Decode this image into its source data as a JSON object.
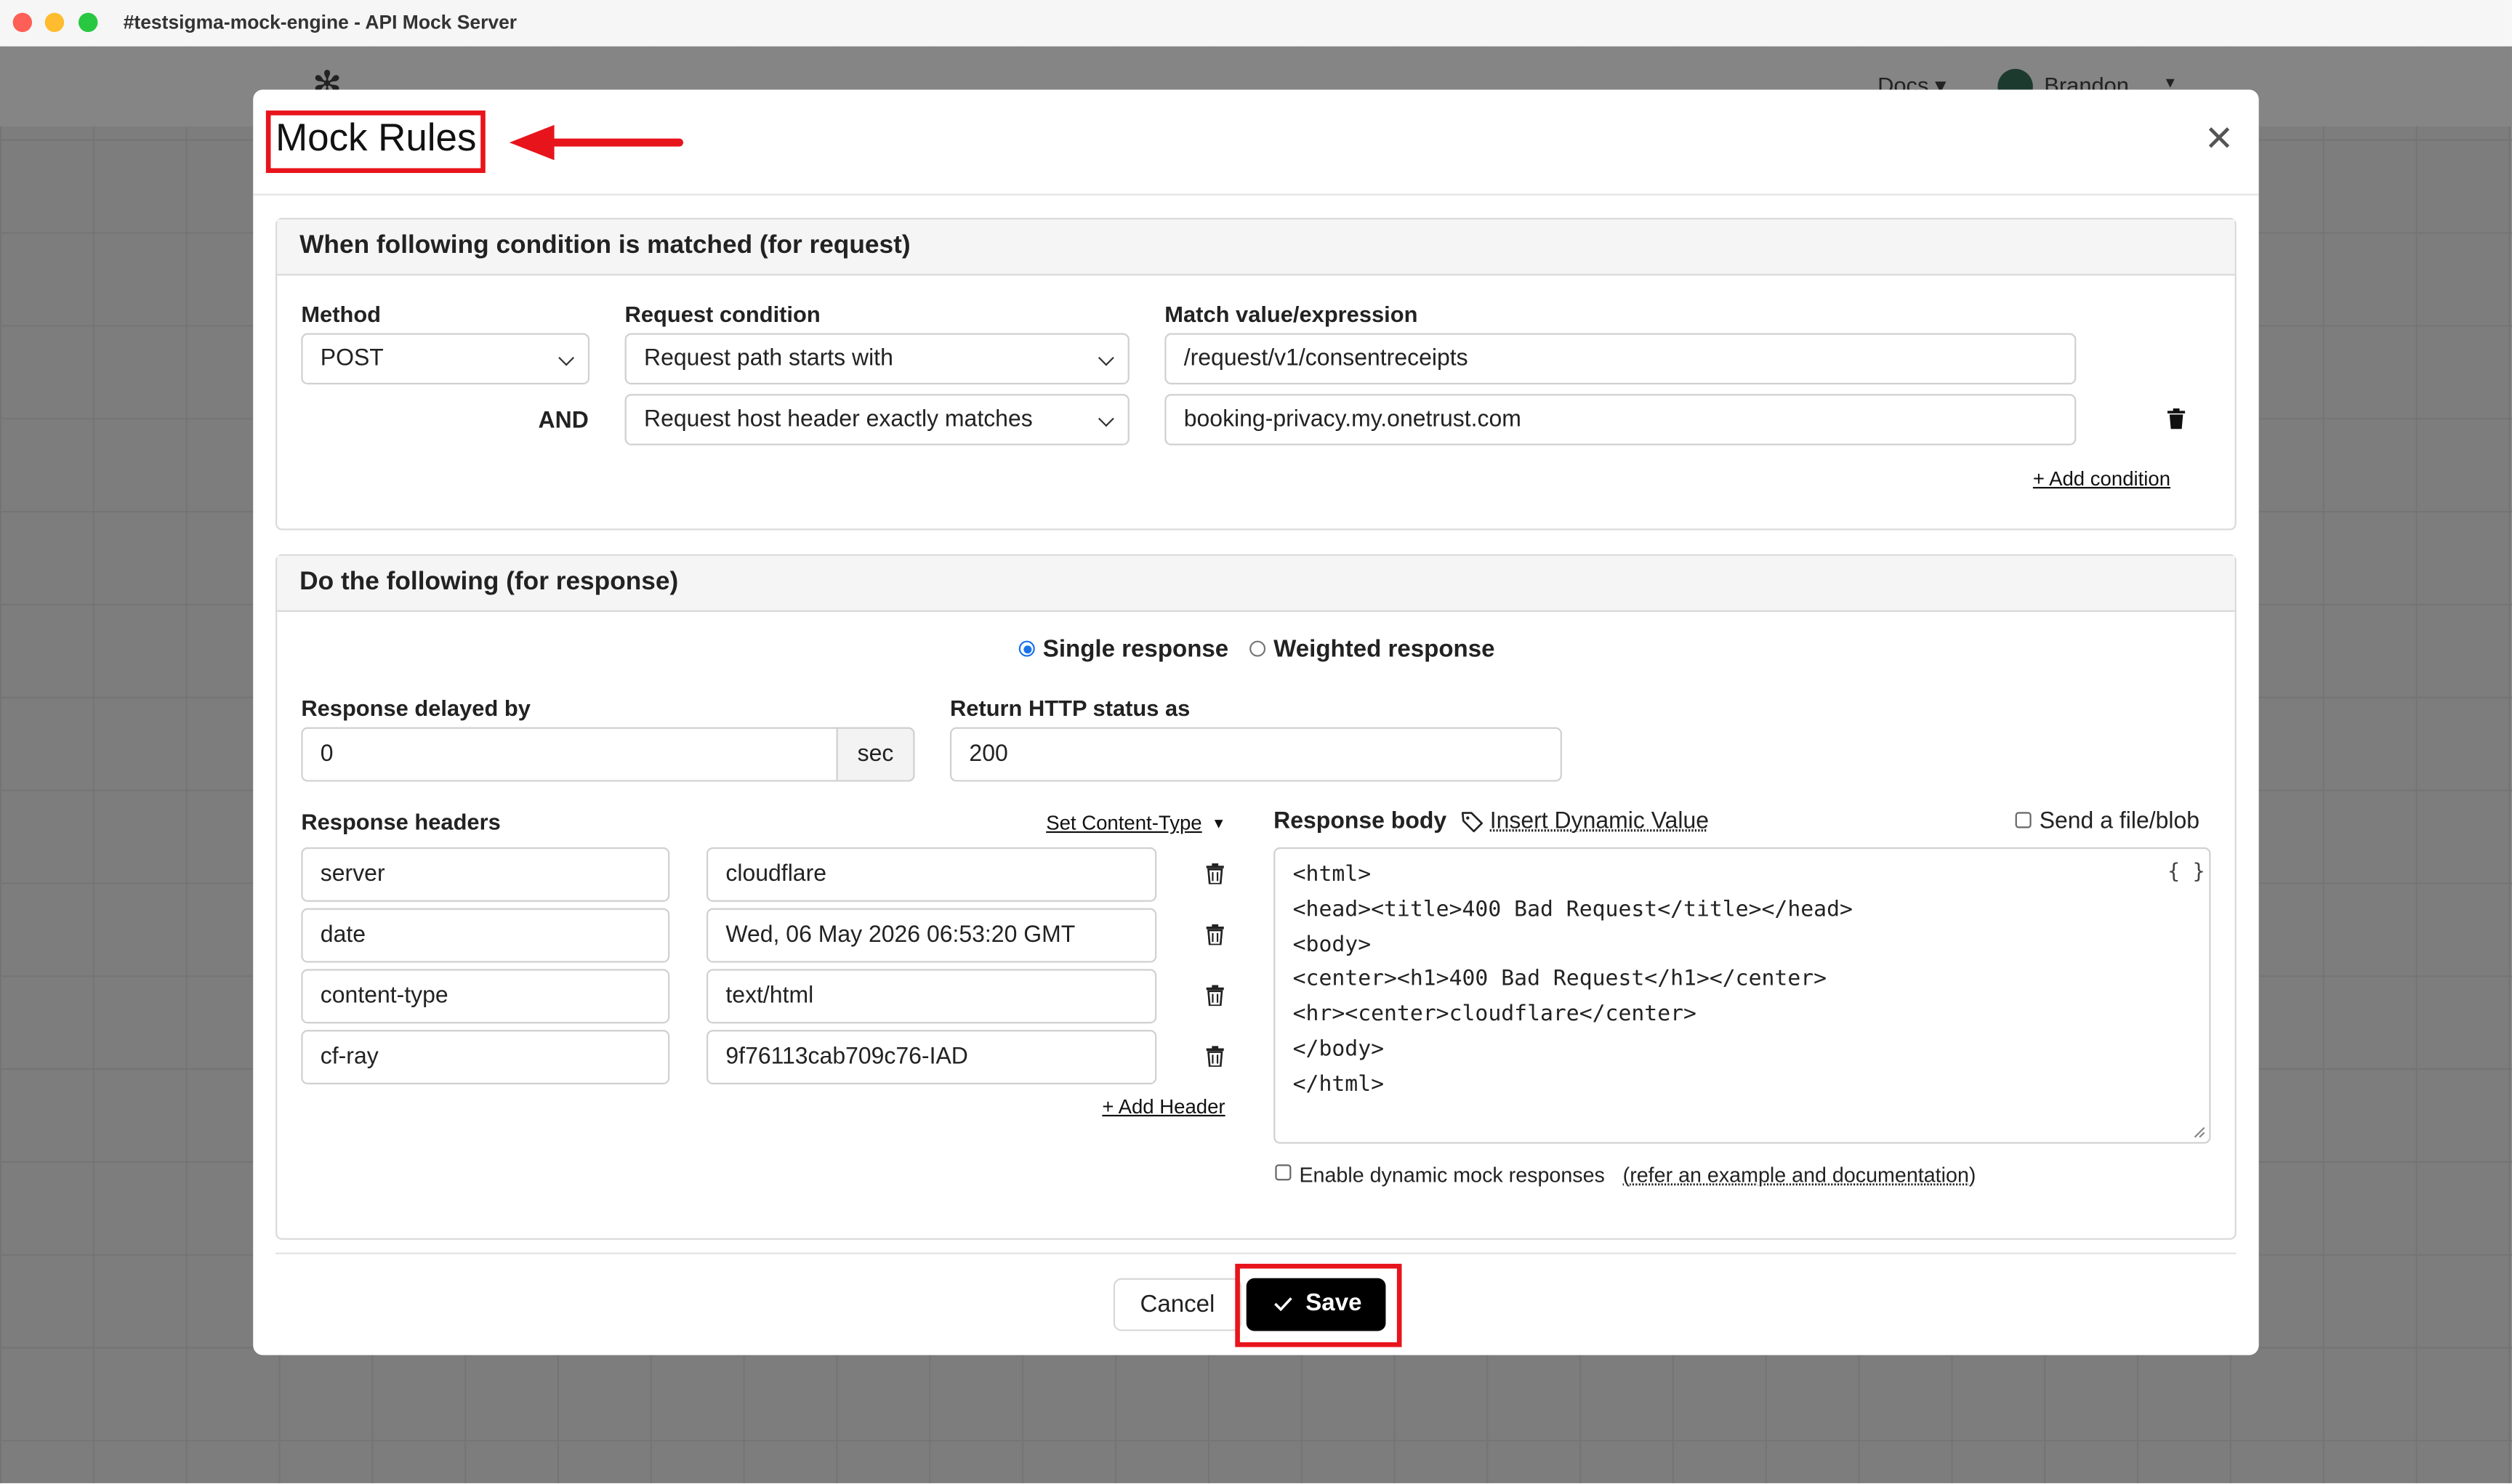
{
  "window": {
    "title": "#testsigma-mock-engine - API Mock Server"
  },
  "background": {
    "nav_docs": "Docs",
    "nav_user": "Brandon"
  },
  "modal": {
    "title": "Mock Rules",
    "request_section": {
      "header": "When following condition is matched (for request)",
      "method_label": "Method",
      "condition_label": "Request condition",
      "match_label": "Match value/expression",
      "method_value": "POST",
      "and_label": "AND",
      "conditions": [
        {
          "type": "Request path starts with",
          "value": "/request/v1/consentreceipts"
        },
        {
          "type": "Request host header exactly matches",
          "value": "booking-privacy.my.onetrust.com"
        }
      ],
      "add_condition": "+ Add condition"
    },
    "response_section": {
      "header": "Do the following (for response)",
      "mode_options": [
        "Single response",
        "Weighted response"
      ],
      "mode_selected": "Single response",
      "delay_label": "Response delayed by",
      "delay_value": "0",
      "delay_unit": "sec",
      "status_label": "Return HTTP status as",
      "status_value": "200",
      "headers_label": "Response headers",
      "set_content_type": "Set Content-Type",
      "headers": [
        {
          "name": "server",
          "value": "cloudflare"
        },
        {
          "name": "date",
          "value": "Wed, 06 May 2026 06:53:20 GMT"
        },
        {
          "name": "content-type",
          "value": "text/html"
        },
        {
          "name": "cf-ray",
          "value": "9f76113cab709c76-IAD"
        }
      ],
      "add_header": "+ Add Header",
      "body_label": "Response body",
      "insert_dynamic": "Insert Dynamic Value",
      "send_file": "Send a file/blob",
      "format_icon": "{ }",
      "body_lines": [
        "<html>",
        "<head><title>400 Bad Request</title></head>",
        "<body>",
        "<center><h1>400 Bad Request</h1></center>",
        "<hr><center>cloudflare</center>",
        "</body>",
        "</html>"
      ],
      "dynamic_label": "Enable dynamic mock responses",
      "dynamic_link": "(refer an example and documentation)"
    },
    "footer": {
      "cancel": "Cancel",
      "save": "Save"
    }
  },
  "annotation_color": "#e8141c"
}
